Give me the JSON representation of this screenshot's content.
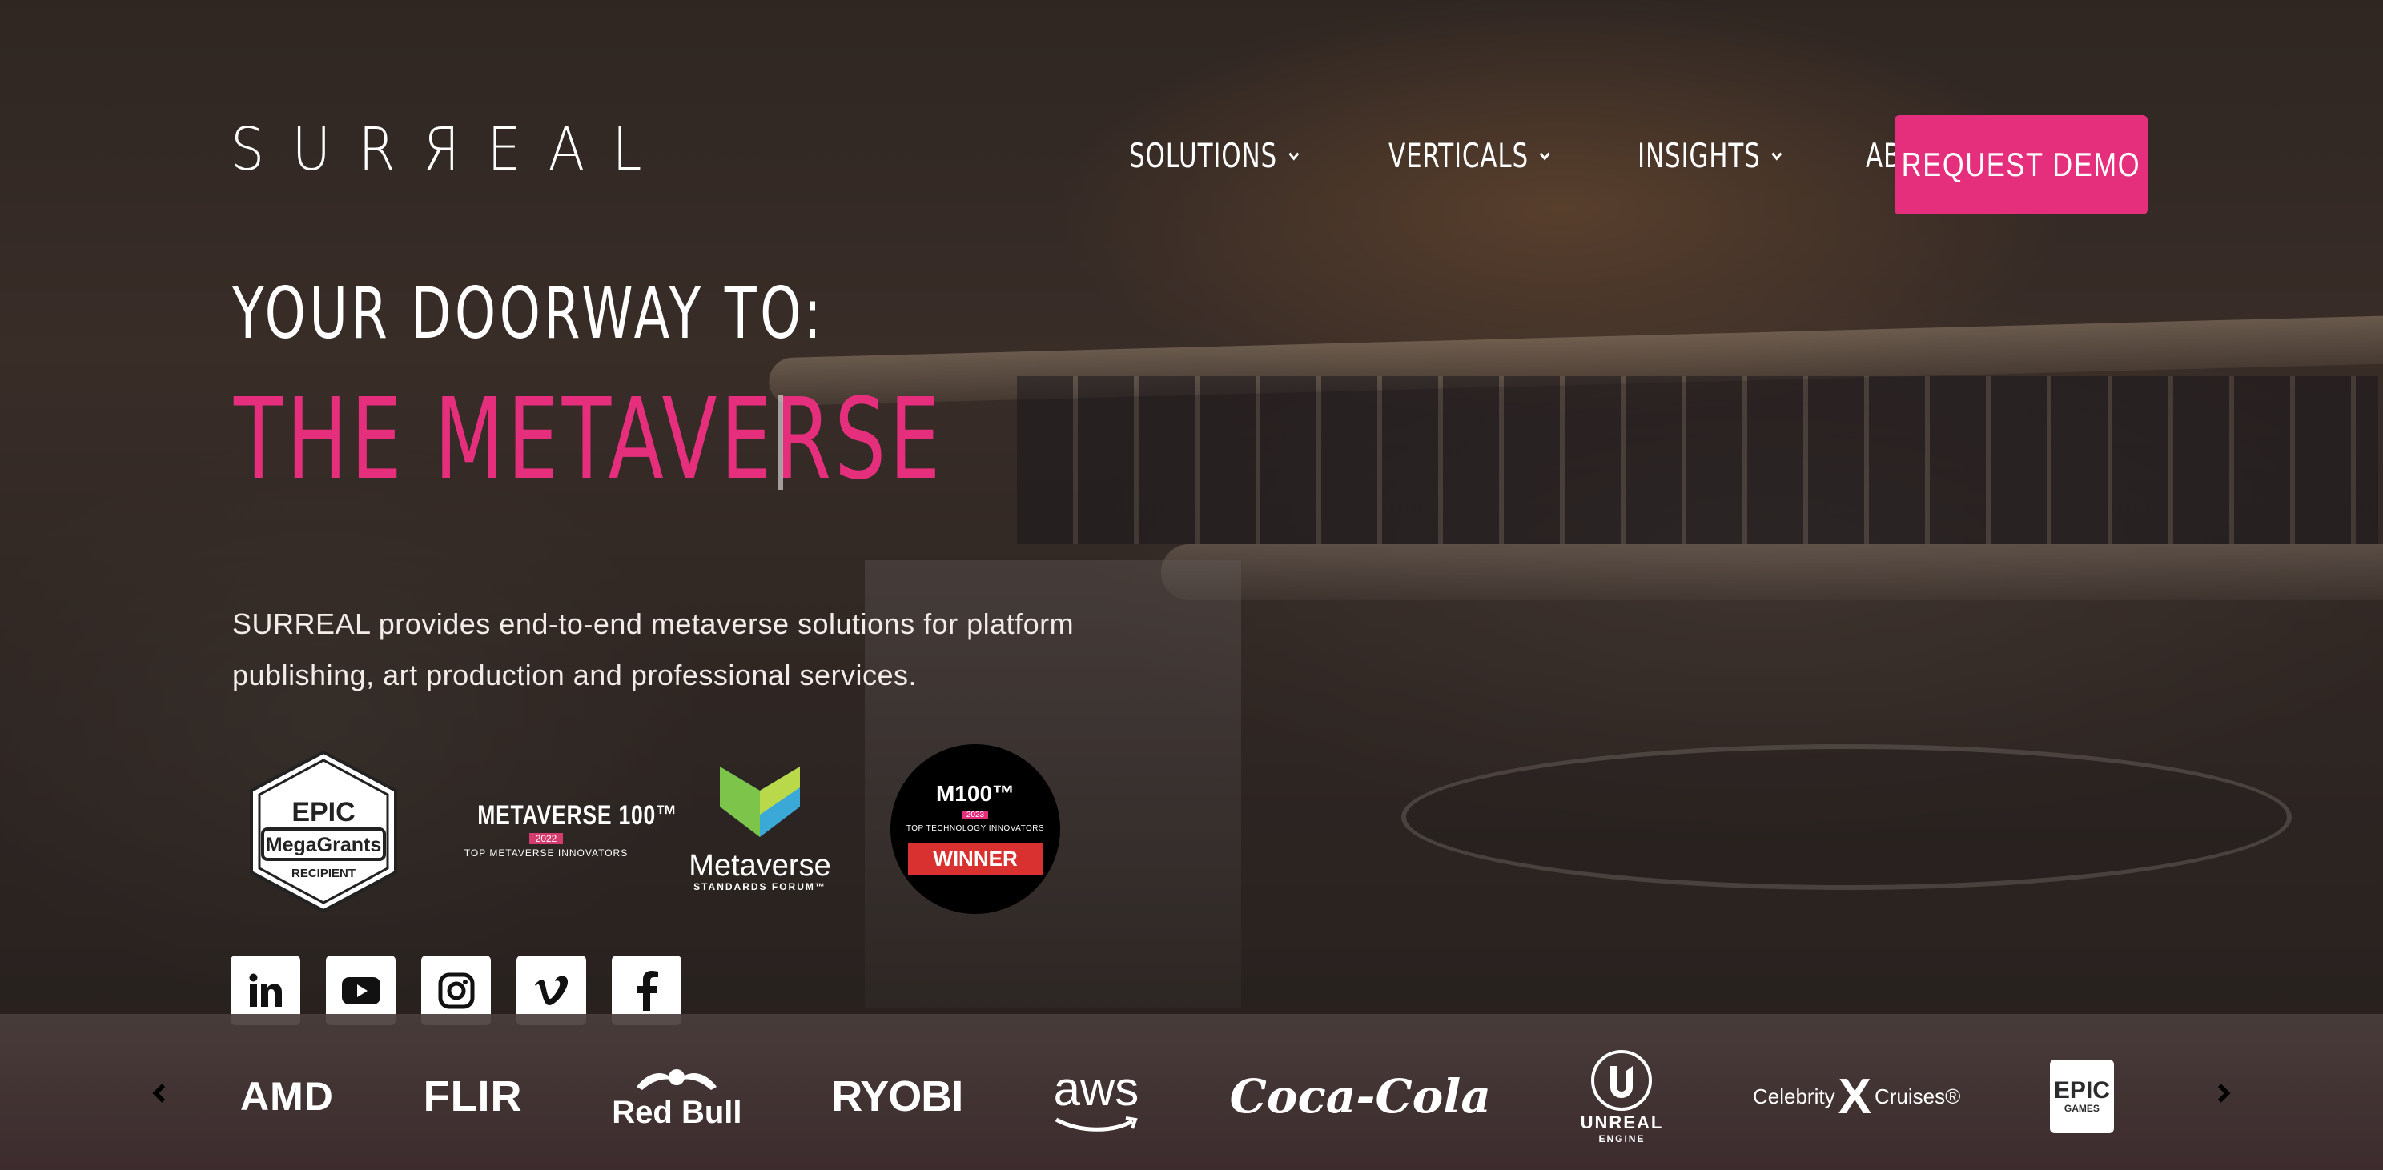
{
  "header": {
    "logo": "SURЯEAL",
    "nav": [
      {
        "label": "SOLUTIONS"
      },
      {
        "label": "VERTICALS"
      },
      {
        "label": "INSIGHTS"
      },
      {
        "label": "ABOUT"
      }
    ],
    "cta_label": "REQUEST DEMO"
  },
  "hero": {
    "kicker": "YOUR DOORWAY TO:",
    "headline": "THE METAVERSE",
    "description": "SURREAL provides end-to-end metaverse solutions for platform publishing, art production and professional services."
  },
  "badges": {
    "epic": {
      "top": "EPIC",
      "middle": "MegaGrants",
      "bottom": "RECIPIENT"
    },
    "metaverse100": {
      "title": "METAVERSE 100™",
      "year": "2022",
      "subtitle": "TOP METAVERSE INNOVATORS"
    },
    "msf": {
      "word": "Metaverse",
      "sub": "STANDARDS FORUM™"
    },
    "winner": {
      "title": "M100™",
      "year": "2023",
      "subtitle": "TOP TECHNOLOGY INNOVATORS",
      "ribbon": "WINNER"
    }
  },
  "social": [
    "linkedin-icon",
    "youtube-icon",
    "instagram-icon",
    "vimeo-icon",
    "facebook-icon"
  ],
  "brands": {
    "amd": "AMD",
    "flir": "FLIR",
    "redbull": "Red Bull",
    "ryobi": "RYOBI",
    "aws": "aws",
    "coke": "Coca-Cola",
    "unreal_top": "UNREAL",
    "unreal_bottom": "ENGINE",
    "celebrity_a": "Celebrity",
    "celebrity_x": "X",
    "celebrity_b": "Cruises®",
    "epic_top": "EPIC",
    "epic_bottom": "GAMES"
  },
  "colors": {
    "accent": "#e52f7d",
    "text": "#ffffff"
  }
}
